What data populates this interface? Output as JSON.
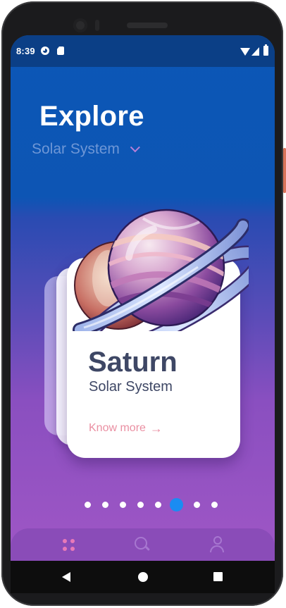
{
  "status_bar": {
    "time": "8:39",
    "icons": [
      "circle-status-icon",
      "sd-card-icon",
      "wifi-icon",
      "cell-signal-icon",
      "battery-icon"
    ]
  },
  "header": {
    "title": "Explore",
    "selector_value": "Solar System"
  },
  "card": {
    "planet_name": "Saturn",
    "planet_system": "Solar System",
    "cta_label": "Know more",
    "cta_arrow": "→"
  },
  "pager": {
    "total": 8,
    "active_index": 5
  },
  "bottom_nav": {
    "items": [
      "grid-icon",
      "search-icon",
      "user-icon"
    ],
    "active_item": "grid-icon"
  },
  "colors": {
    "accent_pink": "#e879b8",
    "cta_pink": "#ea8fa2",
    "title_text": "#3e4765",
    "active_dot": "#1a8cf2"
  }
}
